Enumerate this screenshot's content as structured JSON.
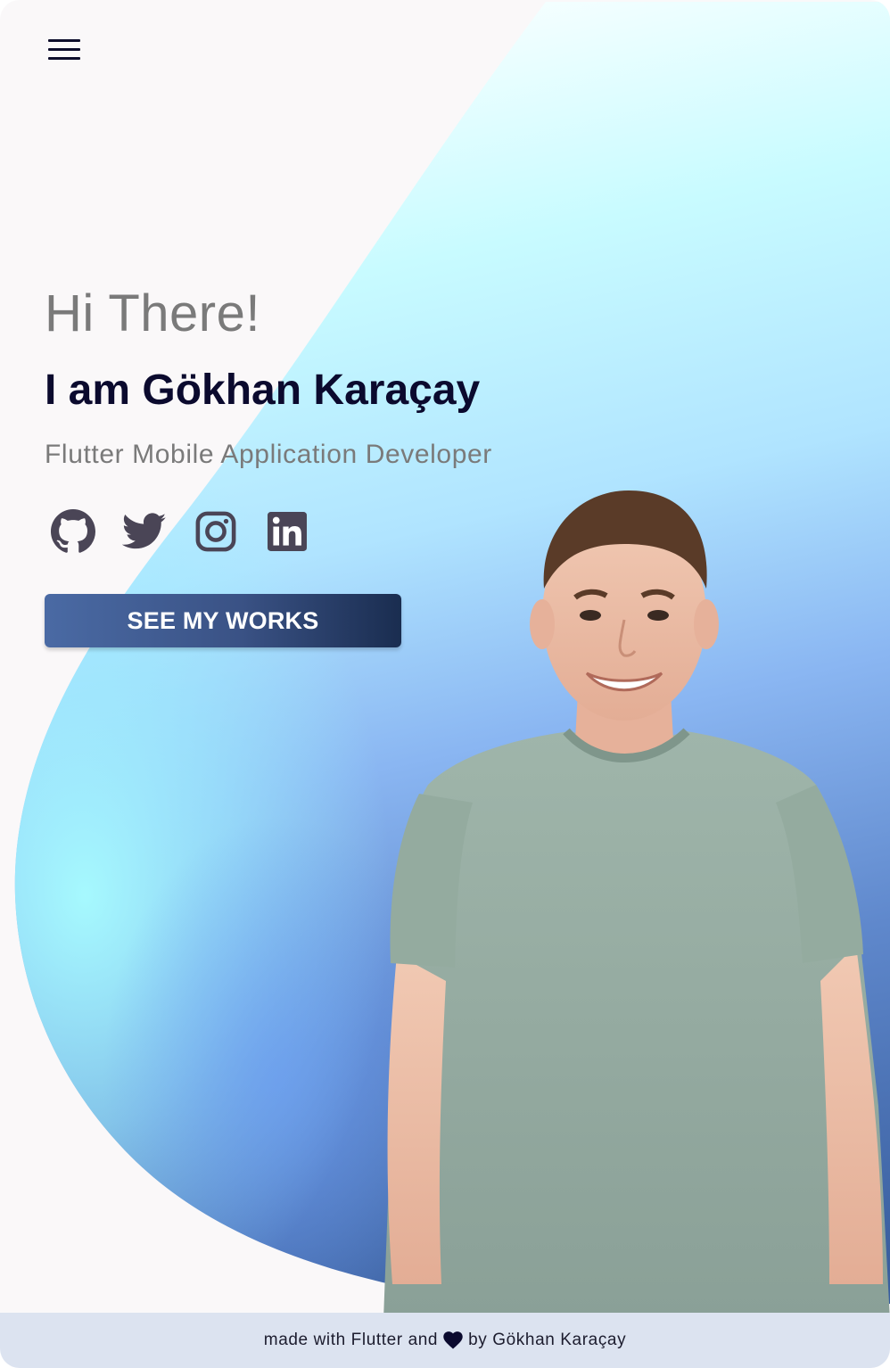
{
  "header": {
    "menu_icon": "hamburger-menu-icon"
  },
  "hero": {
    "greeting": "Hi There!",
    "name": "I am Gökhan Karaçay",
    "role": "Flutter Mobile Application Developer",
    "cta_label": "SEE MY WORKS"
  },
  "socials": [
    {
      "icon": "github-icon"
    },
    {
      "icon": "twitter-icon"
    },
    {
      "icon": "instagram-icon"
    },
    {
      "icon": "linkedin-icon"
    }
  ],
  "footer": {
    "prefix": "made with Flutter and",
    "heart_icon": "heart-icon",
    "suffix": "by Gökhan Karaçay"
  },
  "colors": {
    "background": "#faf8f9",
    "heading": "#0b0a2e",
    "muted_text": "#7a7a7a",
    "icon": "#4a4556",
    "button_start": "#4a6aa4",
    "button_end": "#1a2d50",
    "footer_bg": "#dce3f0",
    "blob_light": "#b6fbff",
    "blob_dark": "#3f64a8"
  }
}
